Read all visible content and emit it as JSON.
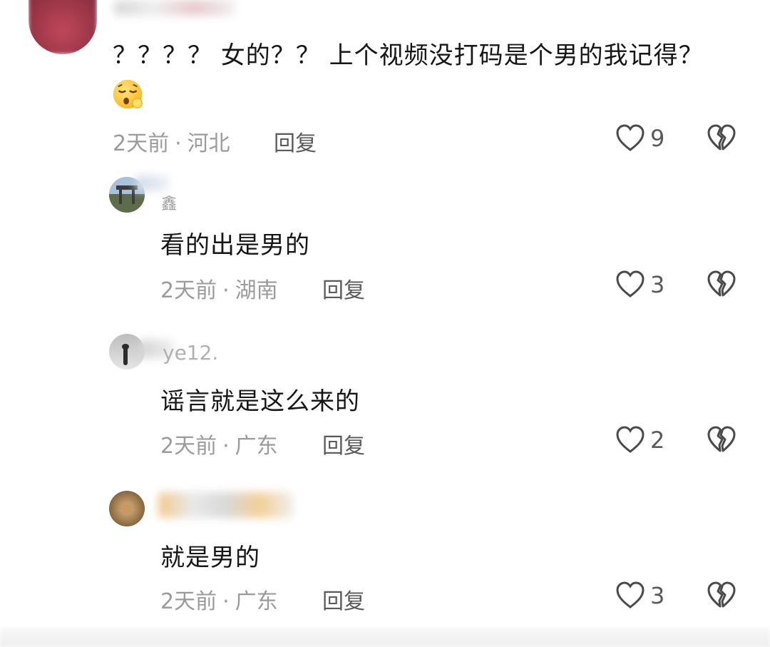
{
  "comments": [
    {
      "text": "？？？？ 女的？？ 上个视频没打码是个男的我记得？",
      "time": "2天前",
      "location": "河北",
      "reply": "回复",
      "likes": "9",
      "avatar_color": "#a23a4a"
    },
    {
      "nickname": "鑫",
      "text": "看的出是男的",
      "time": "2天前",
      "location": "湖南",
      "reply": "回复",
      "likes": "3"
    },
    {
      "nickname": "ye12.",
      "text": "谣言就是这么来的",
      "time": "2天前",
      "location": "广东",
      "reply": "回复",
      "likes": "2"
    },
    {
      "text": "就是男的",
      "time": "2天前",
      "location": "广东",
      "reply": "回复",
      "likes": "3"
    }
  ],
  "separator": "·",
  "icons": {
    "like": "heart-outline-icon",
    "dislike": "broken-heart-icon",
    "emoji": "sleepy-face-emoji-icon"
  }
}
